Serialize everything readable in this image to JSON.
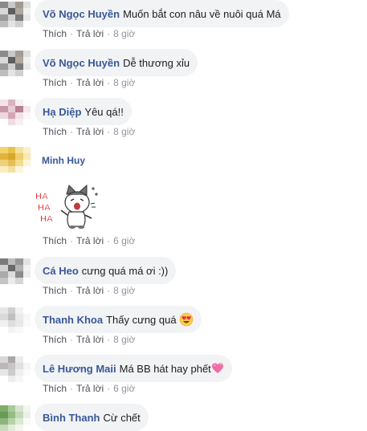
{
  "actions": {
    "like": "Thích",
    "reply": "Trả lời",
    "dot": "·"
  },
  "comments": [
    {
      "name": "Võ Ngọc Huyền",
      "text": "Muốn bắt con nâu về nuôi quá Má",
      "time": "8 giờ"
    },
    {
      "name": "Võ Ngọc Huyền",
      "text": "Dễ thương xỉu",
      "time": "8 giờ"
    },
    {
      "name": "Hạ Diệp",
      "text": "Yêu qá!!",
      "time": "8 giờ"
    },
    {
      "name": "Minh Huy",
      "sticker_text": [
        "HA",
        "HA",
        "HA"
      ],
      "time": "6 giờ"
    },
    {
      "name": "Cá Heo",
      "text": "cưng quá má ơi :))",
      "time": "8 giờ"
    },
    {
      "name": "Thanh Khoa",
      "text": "Thấy cưng quá",
      "emoji": "heart-eyes-emoji",
      "time": "8 giờ"
    },
    {
      "name": "Lê Hương Maii",
      "text": "Má BB hát hay phết",
      "emoji": "sparkling-heart-emoji",
      "time": "6 giờ"
    },
    {
      "name": "Bình Thanh",
      "text": "Cừ chết"
    }
  ],
  "colors": {
    "name": "#385898",
    "bubble": "#f2f3f5",
    "meta": "#90949c"
  }
}
